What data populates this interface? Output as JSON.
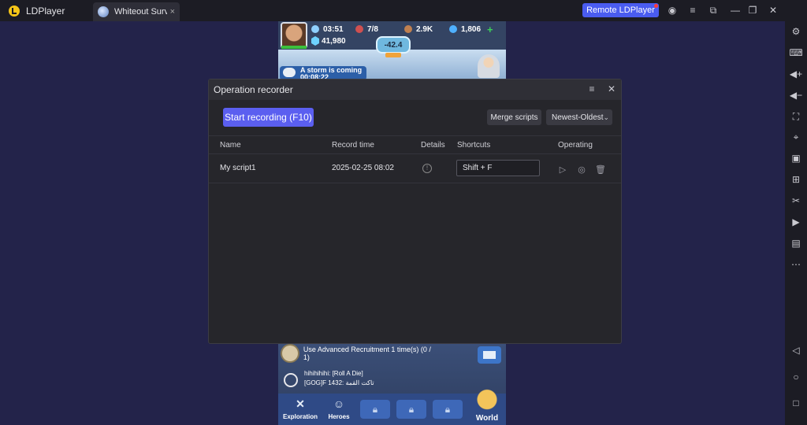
{
  "app": {
    "name": "LDPlayer"
  },
  "tab": {
    "label": "Whiteout Surv...",
    "close": "×"
  },
  "titlebar": {
    "remote_label": "Remote LDPlayer"
  },
  "game": {
    "hud": {
      "time": "03:51",
      "troops": "7/8",
      "food": "2.9K",
      "gems": "1,806",
      "power": "41,980",
      "temperature": "-42.4"
    },
    "storm": {
      "title": "A storm is coming",
      "countdown": "00:08:22"
    },
    "quest": "Use Advanced Recruitment 1 time(s) (0 / 1)",
    "chat": {
      "line1": "hihihihihi: [Roll A Die]",
      "line2": "[GOG]F 1432: تاكت القمة"
    },
    "nav": {
      "exploration": "Exploration",
      "heroes": "Heroes",
      "world": "World"
    }
  },
  "dialog": {
    "title": "Operation recorder",
    "start_button": "Start recording  (F10)",
    "merge_button": "Merge scripts",
    "sort_select": "Newest-Oldest",
    "columns": {
      "name": "Name",
      "record_time": "Record time",
      "details": "Details",
      "shortcuts": "Shortcuts",
      "operating": "Operating"
    },
    "rows": [
      {
        "name": "My script1",
        "record_time": "2025-02-25 08:02",
        "shortcut": "Shift + F"
      }
    ]
  },
  "colors": {
    "accent": "#5b5ff0",
    "remote": "#4a5cf0",
    "bg": "#23234a"
  }
}
